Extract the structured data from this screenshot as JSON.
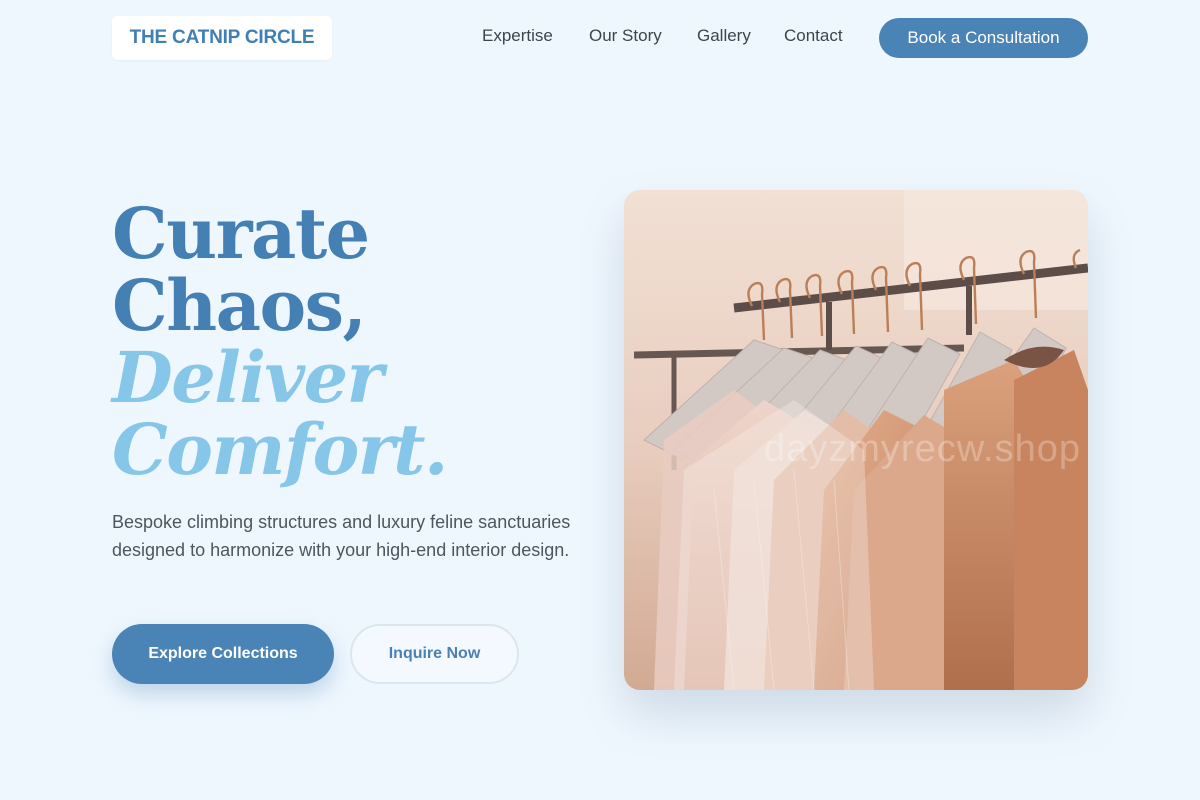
{
  "brand": {
    "name": "THE CATNIP CIRCLE"
  },
  "nav": {
    "items": [
      "Expertise",
      "Our Story",
      "Gallery",
      "Contact"
    ],
    "cta": "Book a Consultation"
  },
  "hero": {
    "title_lines": [
      "Curate",
      "Chaos,",
      "Deliver",
      "Comfort."
    ],
    "description": "Bespoke climbing structures and luxury feline sanctuaries designed to harmonize with your high-end interior design.",
    "primary_button": "Explore Collections",
    "secondary_button": "Inquire Now",
    "image": {
      "subject": "clothing-rack-photo",
      "watermark": "dayzmyrecw.shop"
    }
  },
  "colors": {
    "background": "#eff7fe",
    "accent": "#4a84b7",
    "title_dark": "#4580b4",
    "title_light": "#86c6e8"
  }
}
